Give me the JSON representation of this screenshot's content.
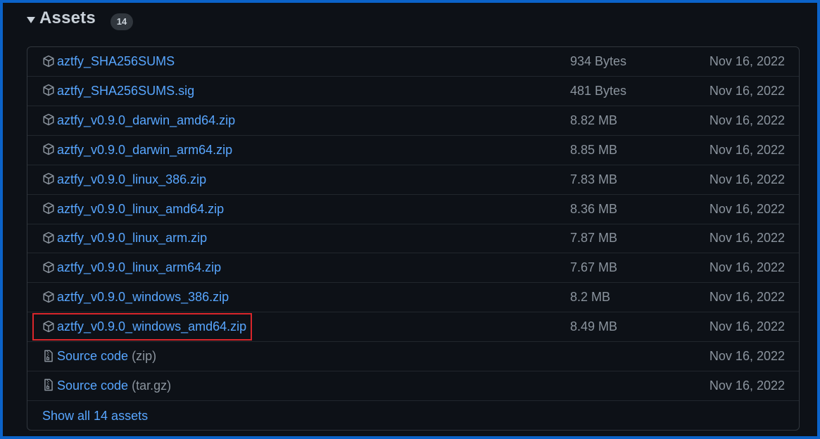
{
  "section": {
    "title": "Assets",
    "count": "14"
  },
  "assets": [
    {
      "name": "aztfy_SHA256SUMS",
      "size": "934 Bytes",
      "date": "Nov 16, 2022",
      "icon": "package-icon"
    },
    {
      "name": "aztfy_SHA256SUMS.sig",
      "size": "481 Bytes",
      "date": "Nov 16, 2022",
      "icon": "package-icon"
    },
    {
      "name": "aztfy_v0.9.0_darwin_amd64.zip",
      "size": "8.82 MB",
      "date": "Nov 16, 2022",
      "icon": "package-icon"
    },
    {
      "name": "aztfy_v0.9.0_darwin_arm64.zip",
      "size": "8.85 MB",
      "date": "Nov 16, 2022",
      "icon": "package-icon"
    },
    {
      "name": "aztfy_v0.9.0_linux_386.zip",
      "size": "7.83 MB",
      "date": "Nov 16, 2022",
      "icon": "package-icon"
    },
    {
      "name": "aztfy_v0.9.0_linux_amd64.zip",
      "size": "8.36 MB",
      "date": "Nov 16, 2022",
      "icon": "package-icon"
    },
    {
      "name": "aztfy_v0.9.0_linux_arm.zip",
      "size": "7.87 MB",
      "date": "Nov 16, 2022",
      "icon": "package-icon"
    },
    {
      "name": "aztfy_v0.9.0_linux_arm64.zip",
      "size": "7.67 MB",
      "date": "Nov 16, 2022",
      "icon": "package-icon"
    },
    {
      "name": "aztfy_v0.9.0_windows_386.zip",
      "size": "8.2 MB",
      "date": "Nov 16, 2022",
      "icon": "package-icon"
    },
    {
      "name": "aztfy_v0.9.0_windows_amd64.zip",
      "size": "8.49 MB",
      "date": "Nov 16, 2022",
      "icon": "package-icon",
      "highlighted": true
    }
  ],
  "source_code": [
    {
      "label": "Source code",
      "suffix": "(zip)",
      "date": "Nov 16, 2022",
      "icon": "file-zip-icon"
    },
    {
      "label": "Source code",
      "suffix": "(tar.gz)",
      "date": "Nov 16, 2022",
      "icon": "file-zip-icon"
    }
  ],
  "show_all_label": "Show all 14 assets",
  "colors": {
    "background": "#0d1117",
    "link": "#58a6ff",
    "muted": "#8b949e",
    "border": "#30363d",
    "frame": "#0b63c9",
    "highlight": "#d9262b"
  }
}
